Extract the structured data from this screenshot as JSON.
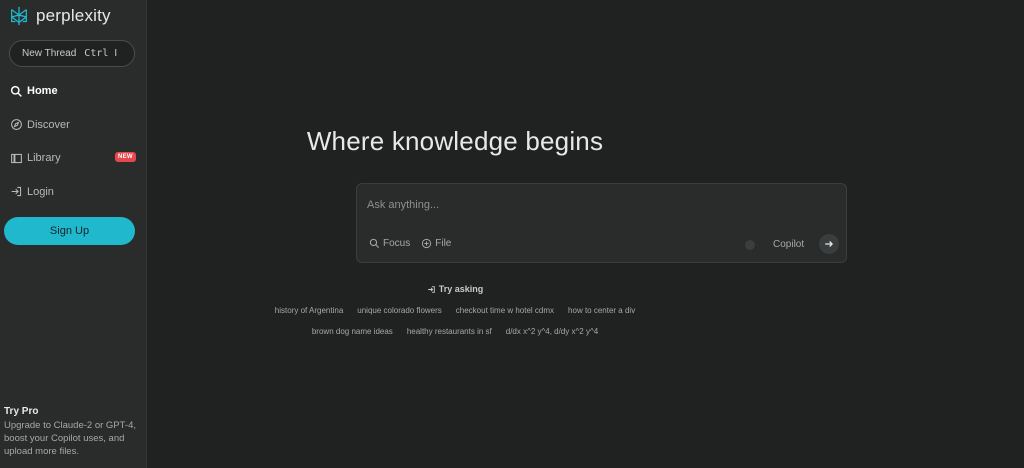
{
  "app": {
    "logo_text": "perplexity"
  },
  "sidebar": {
    "new_thread": {
      "label": "New Thread",
      "shortcut": "Ctrl",
      "shortcut_key": "I"
    },
    "items": [
      {
        "label": "Home",
        "icon": "search-icon",
        "active": true
      },
      {
        "label": "Discover",
        "icon": "compass-icon"
      },
      {
        "label": "Library",
        "icon": "library-icon",
        "badge": "NEW"
      },
      {
        "label": "Login",
        "icon": "login-icon"
      }
    ],
    "signup_label": "Sign Up",
    "try_pro": {
      "title": "Try Pro",
      "description": "Upgrade to Claude-2 or GPT-4, boost your Copilot uses, and upload more files."
    }
  },
  "main": {
    "headline": "Where knowledge begins",
    "ask": {
      "placeholder": "Ask anything...",
      "focus_label": "Focus",
      "file_label": "File",
      "copilot_label": "Copilot"
    },
    "try_asking_label": "Try asking",
    "suggestions_row1": [
      "history of Argentina",
      "unique colorado flowers",
      "checkout time w hotel cdmx",
      "how to center a div"
    ],
    "suggestions_row2": [
      "brown dog name ideas",
      "healthy restaurants in sf",
      "d/dx x^2 y^4, d/dy x^2 y^4"
    ]
  },
  "colors": {
    "accent": "#20b8cd",
    "badge": "#e5484d",
    "background": "#202222",
    "sidebar": "#2a2c2c"
  }
}
